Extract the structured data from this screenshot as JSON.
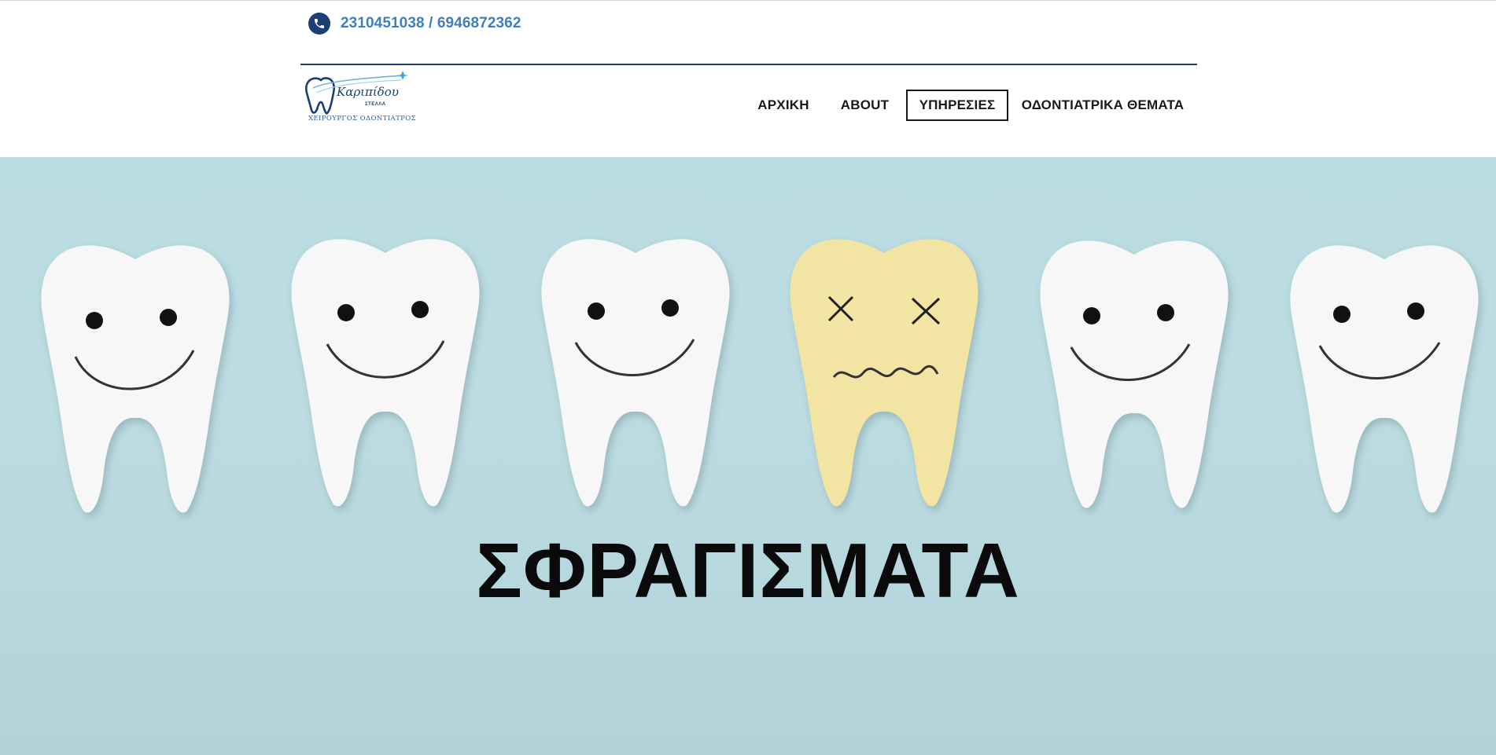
{
  "header": {
    "phone_number_1": "2310451038",
    "phone_separator": " / ",
    "phone_number_2": "6946872362",
    "phone_icon": "phone-icon",
    "logo": {
      "script_text": "Καριπίδου",
      "small_text": "ΣΤΕΛΛΑ",
      "subtitle": "ΧΕΙΡΟΥΡΓΟΣ ΟΔΟΝΤΙΑΤΡΟΣ"
    }
  },
  "nav": {
    "items": [
      {
        "label": "ΑΡΧΙΚΗ",
        "active": false
      },
      {
        "label": "ABOUT",
        "active": false
      },
      {
        "label": "ΥΠΗΡΕΣΙΕΣ",
        "active": true
      },
      {
        "label": "ΟΔΟΝΤΙΑΤΡΙΚΑ ΘΕΜΑΤΑ",
        "active": false
      }
    ]
  },
  "hero": {
    "title": "ΣΦΡΑΓΙΣΜΑΤΑ",
    "image_subject": "row of paper teeth, one yellow sad tooth",
    "colors": {
      "background": "#bcdce2",
      "tooth": "#f7f7f7",
      "sad_tooth": "#f2e4a2",
      "accent": "#1c3f73",
      "phone_text": "#3f7fc0"
    }
  }
}
